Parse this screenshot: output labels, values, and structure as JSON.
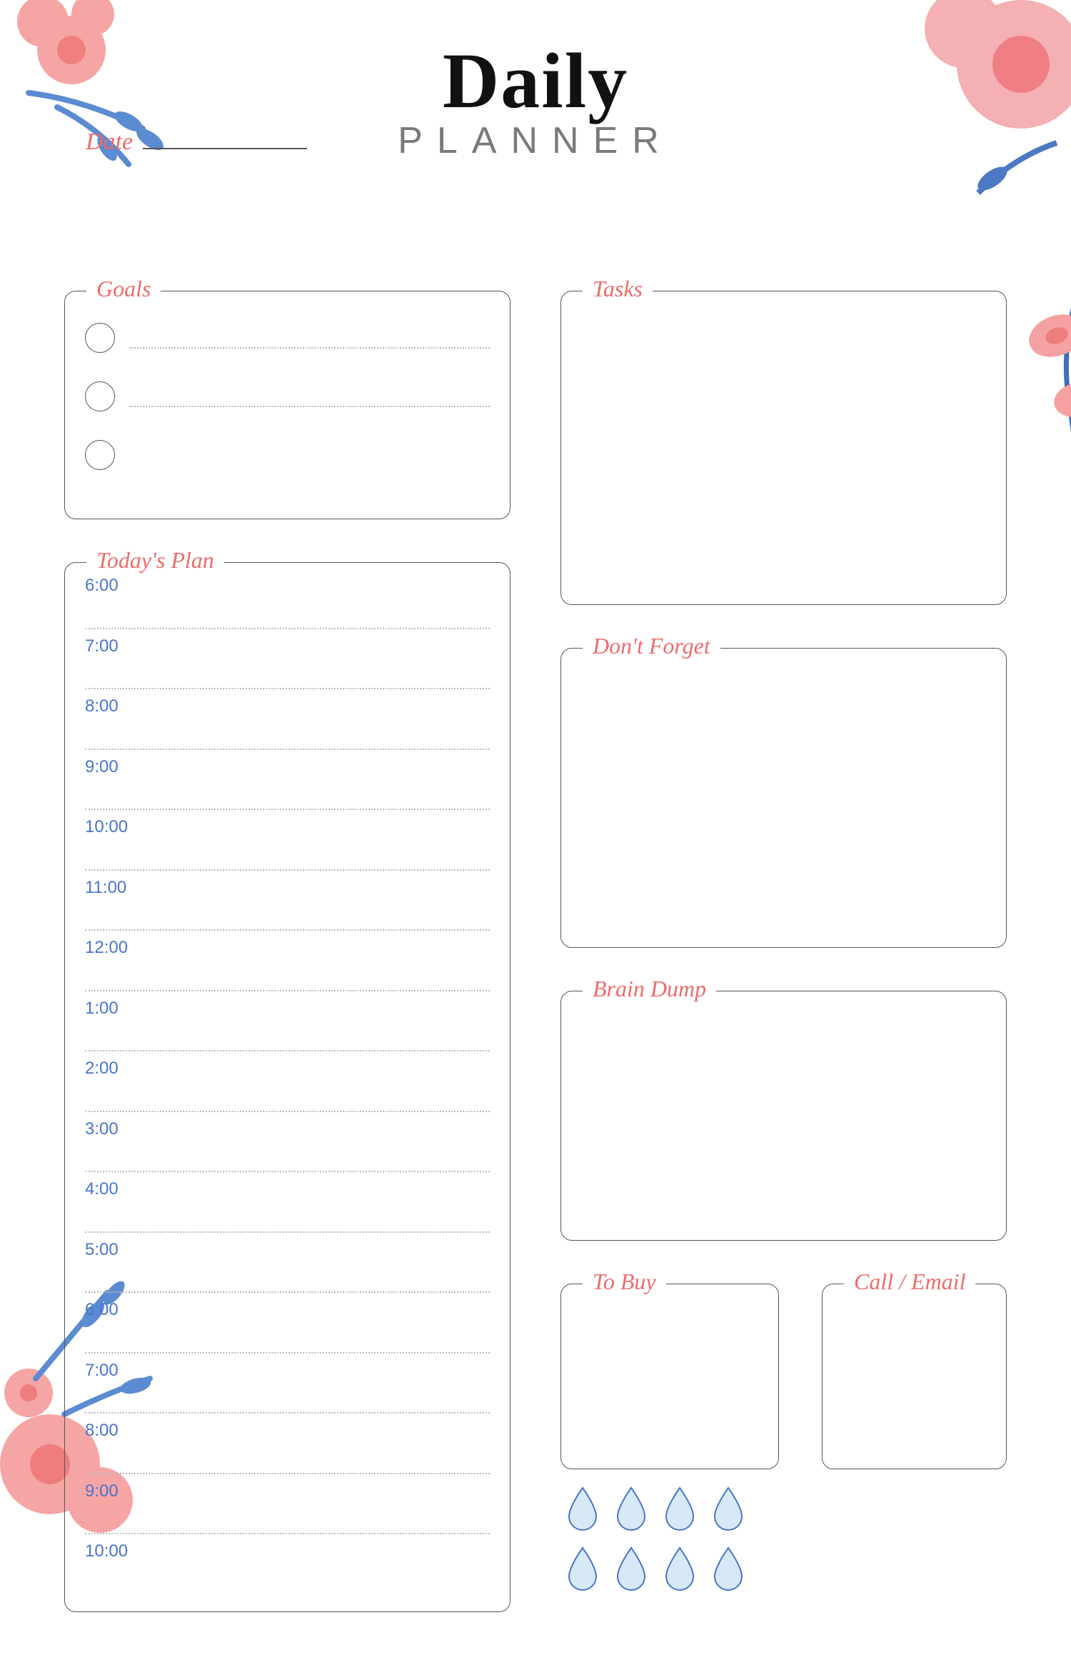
{
  "header": {
    "title_main": "Daily",
    "title_sub": "PLANNER"
  },
  "date": {
    "label": "Date",
    "value": ""
  },
  "sections": {
    "goals": {
      "label": "Goals",
      "items": [
        "",
        "",
        ""
      ]
    },
    "plan": {
      "label": "Today's Plan",
      "hours": [
        "6:00",
        "7:00",
        "8:00",
        "9:00",
        "10:00",
        "11:00",
        "12:00",
        "1:00",
        "2:00",
        "3:00",
        "4:00",
        "5:00",
        "6:00",
        "7:00",
        "8:00",
        "9:00",
        "10:00"
      ]
    },
    "tasks": {
      "label": "Tasks"
    },
    "dontforget": {
      "label": "Don't Forget"
    },
    "braindump": {
      "label": "Brain Dump"
    },
    "tobuy": {
      "label": "To Buy"
    },
    "callemail": {
      "label": "Call / Email"
    }
  },
  "water_tracker": {
    "drop_count": 8
  },
  "colors": {
    "accent": "#ee6b6b",
    "hour": "#4a74c9",
    "border": "#555"
  }
}
